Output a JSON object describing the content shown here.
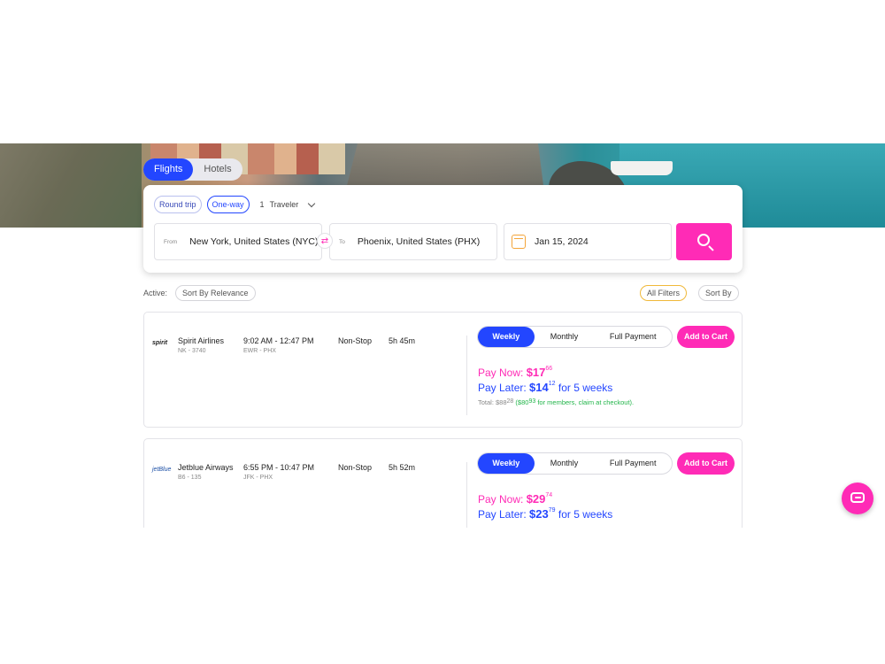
{
  "nav": {
    "tabs": [
      {
        "label": "Flights"
      },
      {
        "label": "Hotels"
      }
    ]
  },
  "search": {
    "trip_types": [
      {
        "label": "Round trip"
      },
      {
        "label": "One-way"
      }
    ],
    "traveler_count": "1",
    "traveler_label": "Traveler",
    "from_label": "From",
    "from_value": "New York, United States (NYC)",
    "to_label": "To",
    "to_value": "Phoenix, United States (PHX)",
    "date_value": "Jan 15, 2024",
    "swap_glyph": "⇄"
  },
  "filters": {
    "active_label": "Active:",
    "sort_relevance": "Sort By Relevance",
    "all_filters": "All Filters",
    "sort_by": "Sort By"
  },
  "results": [
    {
      "logo": "spirit",
      "airline": "Spirit Airlines",
      "flight_no": "NK - 3740",
      "times": "9:02 AM - 12:47 PM",
      "route": "EWR - PHX",
      "stops": "Non-Stop",
      "duration": "5h 45m",
      "plans": {
        "weekly": "Weekly",
        "monthly": "Monthly",
        "full": "Full Payment"
      },
      "add_to_cart": "Add to Cart",
      "pay_now_label": "Pay Now:",
      "pay_now_amount": "$17",
      "pay_now_cents": "66",
      "pay_later_label": "Pay Later:",
      "pay_later_amount": "$14",
      "pay_later_cents": "12",
      "pay_later_suffix": "for 5 weeks",
      "total_label": "Total: $88",
      "total_cents": "28",
      "member_price": "($80",
      "member_cents": "93",
      "member_note": "for members, claim at checkout)."
    },
    {
      "logo": "jetBlue",
      "airline": "Jetblue Airways",
      "flight_no": "B6 - 135",
      "times": "6:55 PM - 10:47 PM",
      "route": "JFK - PHX",
      "stops": "Non-Stop",
      "duration": "5h 52m",
      "plans": {
        "weekly": "Weekly",
        "monthly": "Monthly",
        "full": "Full Payment"
      },
      "add_to_cart": "Add to Cart",
      "pay_now_label": "Pay Now:",
      "pay_now_amount": "$29",
      "pay_now_cents": "74",
      "pay_later_label": "Pay Later:",
      "pay_later_amount": "$23",
      "pay_later_cents": "79",
      "pay_later_suffix": "for 5 weeks"
    }
  ],
  "colors": {
    "brand_blue": "#2346ff",
    "brand_pink": "#ff2bb6",
    "member_green": "#22b54a",
    "calendar_orange": "#f3a53a"
  }
}
